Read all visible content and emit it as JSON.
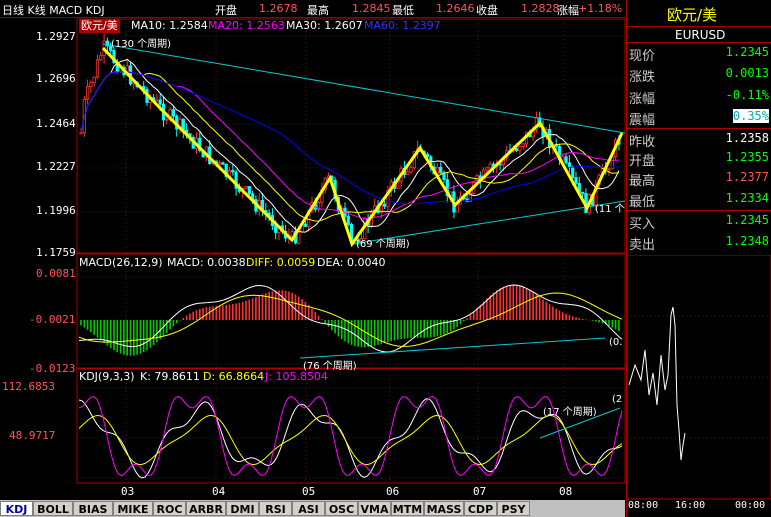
{
  "header": {
    "title": "日线 K线 MACD KDJ",
    "open_label": "开盘",
    "open_value": "1.2678",
    "high_label": "最高",
    "high_value": "1.2845",
    "low_label": "最低",
    "low_value": "1.2646",
    "close_label": "收盘",
    "close_value": "1.2828",
    "change_label": "涨幅",
    "change_value": "+1.18%"
  },
  "price_panel": {
    "symbol_label": "欧元/美",
    "ma10": "MA10: 1.2584",
    "ma20": "MA20: 1.2563",
    "ma30": "MA30: 1.2607",
    "ma60": "MA60: 1.2397",
    "y_ticks": [
      "1.2927",
      "1.2696",
      "1.2464",
      "1.2227",
      "1.1996",
      "1.1759"
    ],
    "annot_top": "(130 个周期)",
    "annot_bottom": "(69 个周期)",
    "annot_right": "(11 个"
  },
  "macd_panel": {
    "label": "MACD(26,12,9)",
    "macd": "MACD: 0.0038",
    "diff": "DIFF: 0.0059",
    "dea": "DEA: 0.0040",
    "y_ticks": [
      "0.0081",
      "-0.0021",
      "-0.0123"
    ],
    "annot": "(76 个周期)",
    "annot_right": "(0."
  },
  "kdj_panel": {
    "label": "KDJ(9,3,3)",
    "k": "K: 79.8611",
    "d": "D: 66.8664",
    "j": "J: 105.8504",
    "y_ticks": [
      "112.6853",
      "48.9717"
    ],
    "annot": "(17 个周期)",
    "annot_right": "(2"
  },
  "x_ticks": [
    "03",
    "04",
    "05",
    "06",
    "07",
    "08"
  ],
  "side": {
    "title": "欧元/美",
    "symbol": "EURUSD",
    "rows": [
      {
        "label": "现价",
        "value": "1.2345",
        "color": "#00ff00"
      },
      {
        "label": "涨跌",
        "value": "0.0013",
        "color": "#00ff00"
      },
      {
        "label": "涨幅",
        "value": "-0.11%",
        "color": "#00ff00"
      },
      {
        "label": "震幅",
        "value": "0.35%",
        "color": "#00ffff"
      },
      {
        "label": "昨收",
        "value": "1.2358",
        "color": "#ffffff"
      },
      {
        "label": "开盘",
        "value": "1.2355",
        "color": "#00ff00"
      },
      {
        "label": "最高",
        "value": "1.2377",
        "color": "#ff5555"
      },
      {
        "label": "最低",
        "value": "1.2334",
        "color": "#00ff00"
      },
      {
        "label": "买入",
        "value": "1.2345",
        "color": "#00ff00"
      },
      {
        "label": "卖出",
        "value": "1.2348",
        "color": "#00ff00"
      }
    ],
    "time_ticks": [
      "08:00",
      "16:00",
      "00:00"
    ]
  },
  "tabs": [
    "KDJ",
    "BOLL",
    "BIAS",
    "MIKE",
    "ROC",
    "ARBR",
    "DMI",
    "RSI",
    "ASI",
    "OSC",
    "VMA",
    "MTM",
    "MASS",
    "CDP",
    "PSY"
  ],
  "colors": {
    "up": "#ff3333",
    "down": "#00ffff",
    "ma10": "#ffffff",
    "ma20": "#ffff00",
    "ma30": "#ff00ff",
    "ma60": "#0000ff",
    "trend": "#ffff00",
    "channel": "#00cccc",
    "grid": "#800000"
  }
}
